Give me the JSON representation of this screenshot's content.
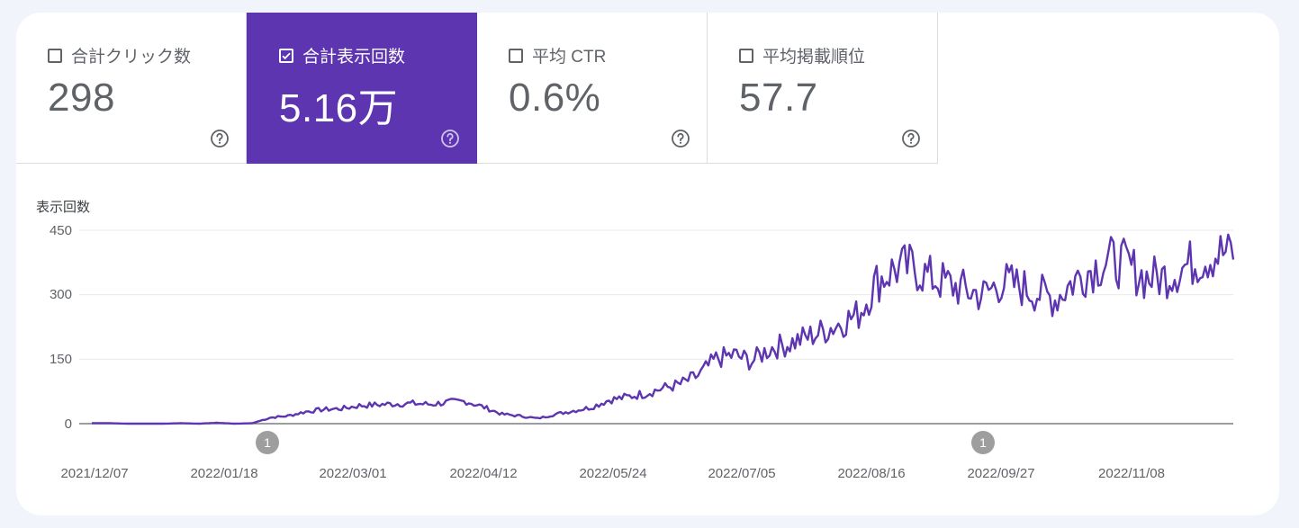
{
  "metrics": [
    {
      "label": "合計クリック数",
      "value": "298",
      "checked": false
    },
    {
      "label": "合計表示回数",
      "value": "5.16万",
      "checked": true
    },
    {
      "label": "平均 CTR",
      "value": "0.6%",
      "checked": false
    },
    {
      "label": "平均掲載順位",
      "value": "57.7",
      "checked": false
    }
  ],
  "colors": {
    "accent": "#5e35b1",
    "line": "#5e35b1",
    "grid": "#e8eaed"
  },
  "chart_data": {
    "type": "line",
    "ylabel": "表示回数",
    "ylim": [
      0,
      450
    ],
    "yticks": [
      "450",
      "300",
      "150",
      "0"
    ],
    "x_tick_labels": [
      "2021/12/07",
      "2022/01/18",
      "2022/03/01",
      "2022/04/12",
      "2022/05/24",
      "2022/07/05",
      "2022/08/16",
      "2022/09/27",
      "2022/11/08"
    ],
    "annotations": [
      {
        "date": "2022/01/16",
        "label": "1"
      },
      {
        "date": "2022/10/02",
        "label": "1"
      }
    ],
    "series": [
      {
        "values_weekly_start": "2021/12/07",
        "values": [
          1,
          1,
          0,
          0,
          0,
          1,
          0,
          2,
          0,
          1,
          14,
          18,
          28,
          33,
          35,
          42,
          44,
          46,
          47,
          45,
          50,
          52,
          38,
          22,
          18,
          12,
          22,
          30,
          38,
          55,
          62,
          70,
          82,
          92,
          112,
          150,
          160,
          145,
          175,
          185,
          200,
          215,
          235,
          255,
          330,
          360,
          365,
          340,
          325,
          310,
          300,
          330,
          320,
          305,
          290,
          330,
          360,
          380,
          370,
          340,
          340,
          360,
          380,
          395,
          400
        ]
      }
    ]
  }
}
